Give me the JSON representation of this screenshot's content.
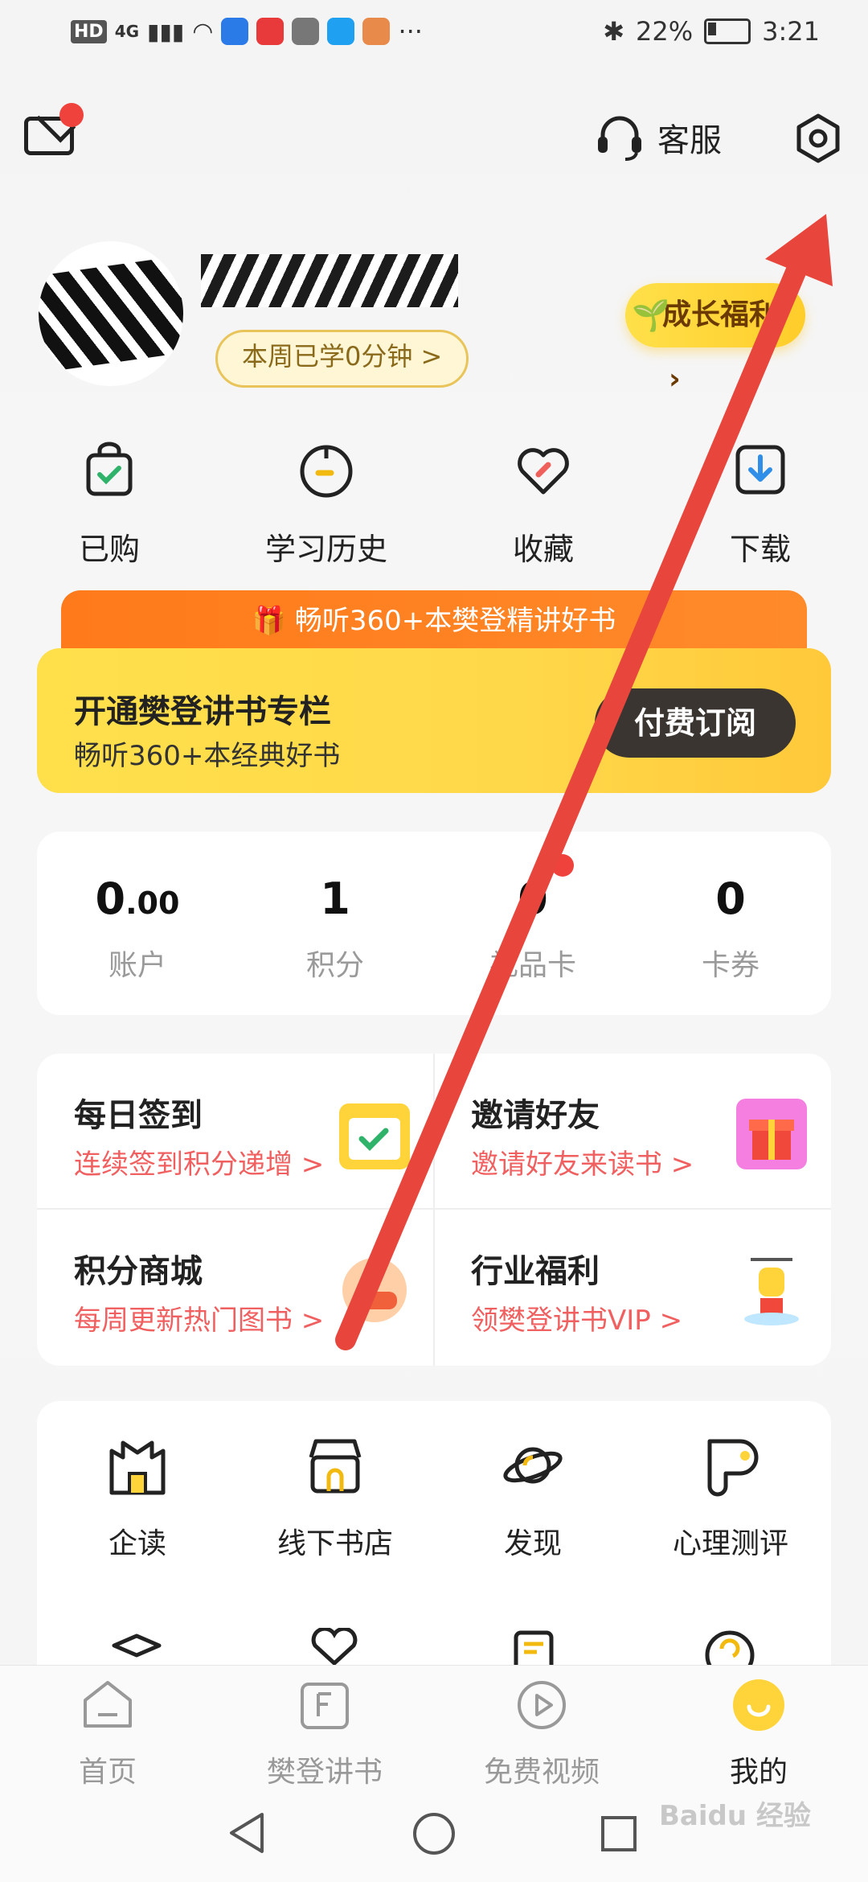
{
  "status_bar": {
    "battery": "22%",
    "time": "3:21",
    "network": "4G",
    "hd": "HD"
  },
  "header": {
    "customer_service": "客服"
  },
  "profile": {
    "study_time": "本周已学0分钟 >",
    "growth_benefit": "成长福利"
  },
  "quick_actions": [
    {
      "label": "已购",
      "icon": "bag-check-icon"
    },
    {
      "label": "学习历史",
      "icon": "clock-icon"
    },
    {
      "label": "收藏",
      "icon": "heart-icon"
    },
    {
      "label": "下载",
      "icon": "download-icon"
    }
  ],
  "promo": {
    "banner": "畅听360+本樊登精讲好书",
    "title": "开通樊登讲书专栏",
    "subtitle": "畅听360+本经典好书",
    "button": "付费订阅"
  },
  "stats": [
    {
      "value_int": "0",
      "value_dec": ".00",
      "label": "账户"
    },
    {
      "value_int": "1",
      "value_dec": "",
      "label": "积分"
    },
    {
      "value_int": "0",
      "value_dec": "",
      "label": "礼品卡"
    },
    {
      "value_int": "0",
      "value_dec": "",
      "label": "卡券"
    }
  ],
  "tasks": [
    {
      "title": "每日签到",
      "subtitle": "连续签到积分递增 >"
    },
    {
      "title": "邀请好友",
      "subtitle": "邀请好友来读书 >"
    },
    {
      "title": "积分商城",
      "subtitle": "每周更新热门图书 >"
    },
    {
      "title": "行业福利",
      "subtitle": "领樊登讲书VIP >"
    }
  ],
  "services": [
    {
      "label": "企读"
    },
    {
      "label": "线下书店"
    },
    {
      "label": "发现"
    },
    {
      "label": "心理测评"
    }
  ],
  "bottom_nav": [
    {
      "label": "首页"
    },
    {
      "label": "樊登讲书"
    },
    {
      "label": "免费视频"
    },
    {
      "label": "我的"
    }
  ],
  "watermark": "Baidu 经验",
  "colors": {
    "accent_yellow": "#ffd84a",
    "accent_orange": "#ff7a1a",
    "annotation_red": "#e8463c"
  }
}
